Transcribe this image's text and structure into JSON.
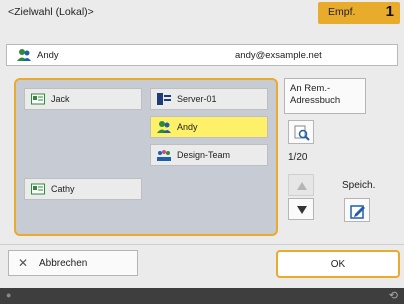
{
  "header": {
    "title": "<Zielwahl (Lokal)>",
    "recipient_label": "Empf.",
    "recipient_count": "1"
  },
  "selected": {
    "name": "Andy",
    "email": "andy@exsample.net",
    "icon": "group-person-icon"
  },
  "list": {
    "entries": [
      {
        "label": "Jack",
        "icon": "card-icon",
        "selected": false
      },
      {
        "label": "Cathy",
        "icon": "card-icon",
        "selected": false
      },
      {
        "label": "Server-01",
        "icon": "server-icon",
        "selected": false
      },
      {
        "label": "Andy",
        "icon": "group-person-icon",
        "selected": true
      },
      {
        "label": "Design-Team",
        "icon": "team-icon",
        "selected": false
      }
    ]
  },
  "controls": {
    "remote_address_book": "An Rem.-\nAdressbuch",
    "page_indicator": "1/20",
    "save_label": "Speich."
  },
  "footer": {
    "cancel_label": "Abbrechen",
    "ok_label": "OK"
  },
  "colors": {
    "accent": "#e8ab2b",
    "selected_entry": "#fff06a",
    "panel": "#c7ccd4"
  }
}
